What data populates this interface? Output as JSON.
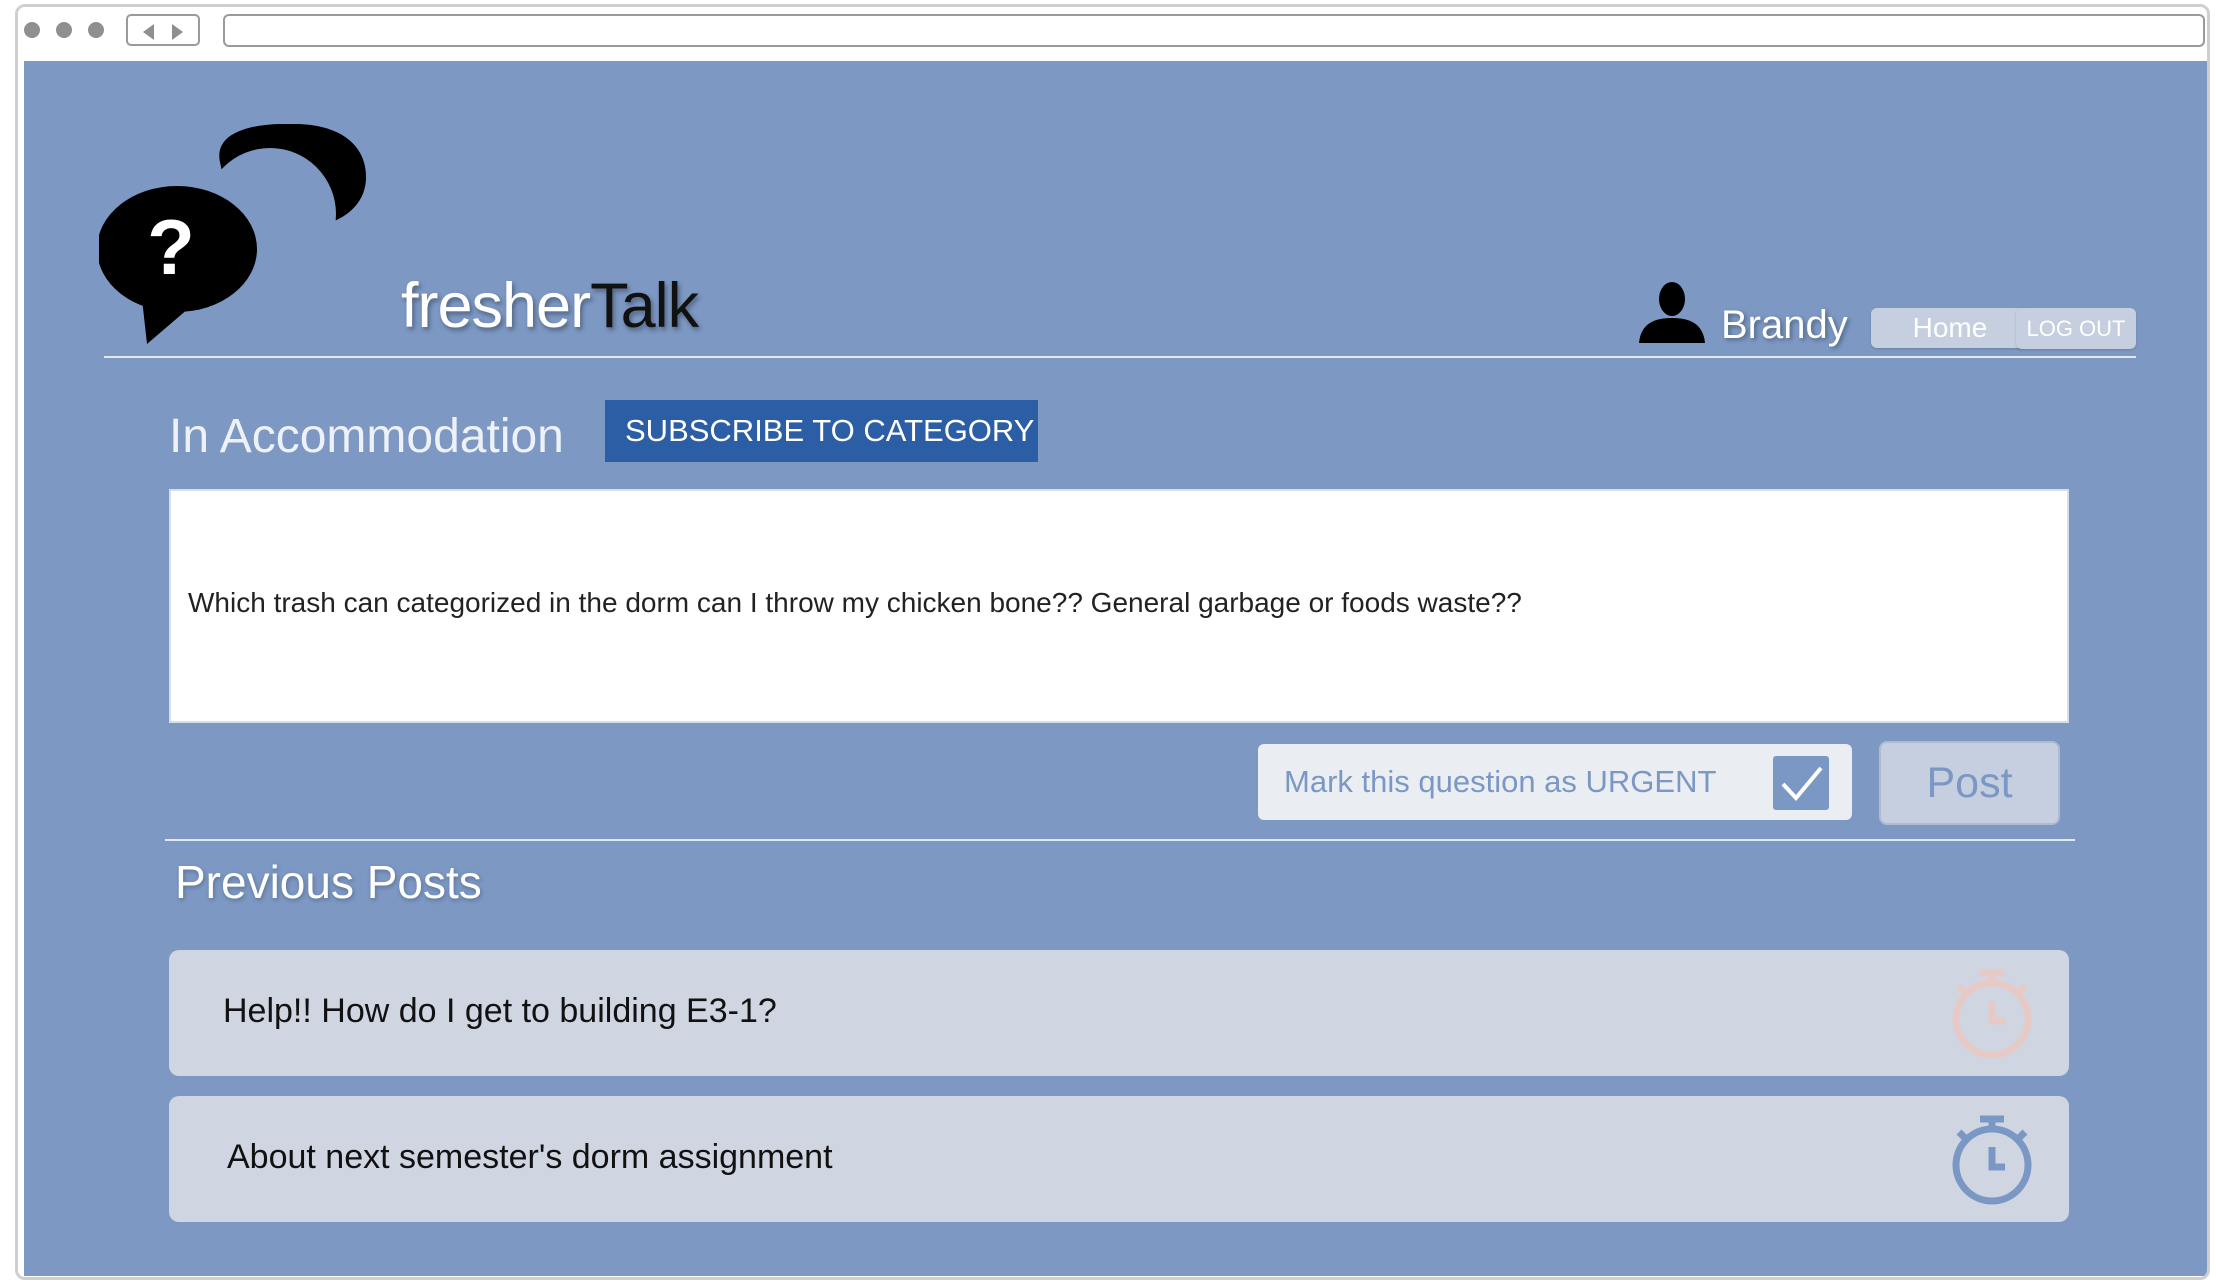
{
  "brand": {
    "part1": "fresher",
    "part2": "Talk"
  },
  "user": {
    "name": "Brandy"
  },
  "nav": {
    "home_label": "Home",
    "logout_label": "LOG OUT"
  },
  "category": {
    "title": "In Accommodation",
    "subscribe_label": "SUBSCRIBE TO CATEGORY"
  },
  "question": {
    "text": "Which trash can categorized in the dorm can I throw my chicken bone?? General garbage or foods waste??"
  },
  "urgent": {
    "label": "Mark this question as URGENT",
    "checked": true
  },
  "post_button": {
    "label": "Post"
  },
  "previous_posts": {
    "title": "Previous Posts",
    "items": [
      {
        "title": "Help!! How do I get to building E3-1?",
        "icon": "clock-icon",
        "icon_color": "#e7c9c6",
        "urgent": true
      },
      {
        "title": "About next semester's dorm assignment",
        "icon": "clock-icon",
        "icon_color": "#7b98c5",
        "urgent": false
      }
    ]
  },
  "colors": {
    "background": "#7c98c3",
    "subscribe_button": "#2c5ea5",
    "pill_button": "#c5cfdf",
    "accent": "#7b98c5"
  }
}
